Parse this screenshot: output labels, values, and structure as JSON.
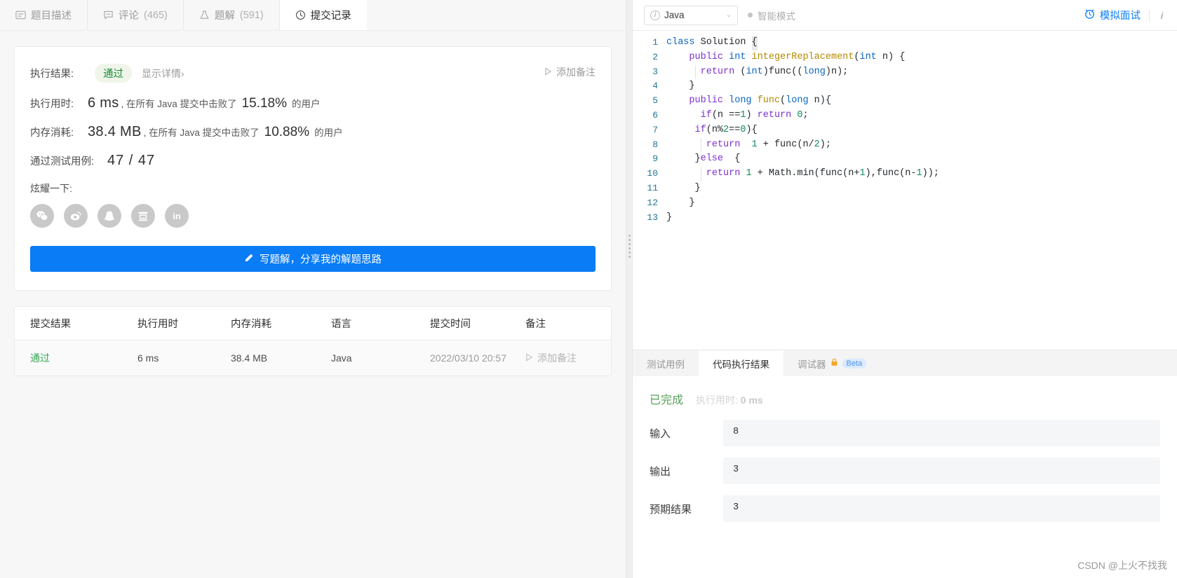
{
  "left": {
    "tabs": [
      {
        "label": "题目描述",
        "icon": "description-icon",
        "count": "",
        "active": false
      },
      {
        "label": "评论",
        "icon": "comment-icon",
        "count": "(465)",
        "active": false
      },
      {
        "label": "题解",
        "icon": "flask-icon",
        "count": "(591)",
        "active": false
      },
      {
        "label": "提交记录",
        "icon": "clock-icon",
        "count": "",
        "active": true
      }
    ],
    "result": {
      "exec_result_label": "执行结果:",
      "status": "通过",
      "show_detail": "显示详情",
      "show_detail_chevron": "›",
      "add_note_label": "添加备注",
      "runtime_label": "执行用时:",
      "runtime_value": "6 ms",
      "runtime_mid": ", 在所有 Java 提交中击败了",
      "runtime_pct": "15.18%",
      "runtime_suffix": "的用户",
      "memory_label": "内存消耗:",
      "memory_value": "38.4 MB",
      "memory_mid": ", 在所有 Java 提交中击败了",
      "memory_pct": "10.88%",
      "memory_suffix": "的用户",
      "testcase_label": "通过测试用例:",
      "testcase_value": "47 / 47",
      "share_label": "炫耀一下:",
      "share_icons": [
        "wechat-icon",
        "weibo-icon",
        "qq-icon",
        "douban-icon",
        "linkedin-icon"
      ],
      "write_button": "写题解，分享我的解题思路",
      "write_button_icon": "pencil-icon"
    },
    "table": {
      "headers": [
        "提交结果",
        "执行用时",
        "内存消耗",
        "语言",
        "提交时间",
        "备注"
      ],
      "rows": [
        {
          "status": "通过",
          "runtime": "6 ms",
          "memory": "38.4 MB",
          "language": "Java",
          "time": "2022/03/10 20:57",
          "note": "添加备注",
          "note_icon": "play-outline-icon"
        }
      ]
    }
  },
  "right": {
    "header": {
      "language": "Java",
      "language_info_icon": "info-circle-icon",
      "chevron": "⌄",
      "smart_mode": "智能模式",
      "mock_interview": "模拟面试",
      "mock_icon": "alarm-clock-icon",
      "info_icon": "italic-i-icon"
    },
    "editor": {
      "lines": [
        {
          "n": "1",
          "html": "<span class='kw2'>class</span> <span class='id'>Solution</span> <span class='caret'>{</span>"
        },
        {
          "n": "2",
          "html": "    <span class='kw'>public</span> <span class='ty'>int</span> <span class='fn'>integerReplacement</span>(<span class='ty'>int</span> n) {"
        },
        {
          "n": "3",
          "html": "     <span class='guide'></span> <span class='kw'>return</span> (<span class='ty'>int</span>)func((<span class='ty'>long</span>)n);"
        },
        {
          "n": "4",
          "html": "    }"
        },
        {
          "n": "5",
          "html": "    <span class='kw'>public</span> <span class='ty'>long</span> <span class='fn'>func</span>(<span class='ty'>long</span> n){"
        },
        {
          "n": "6",
          "html": "      <span class='kw'>if</span>(n ==<span class='num'>1</span>) <span class='kw'>return</span> <span class='num'>0</span>;"
        },
        {
          "n": "7",
          "html": "     <span class='kw'>if</span>(n%<span class='num'>2</span>==<span class='num'>0</span>){"
        },
        {
          "n": "8",
          "html": "      <span class='guide'></span> <span class='kw'>return</span>  <span class='num'>1</span> + func(n/<span class='num'>2</span>);"
        },
        {
          "n": "9",
          "html": "     }<span class='kw'>else</span>  {"
        },
        {
          "n": "10",
          "html": "      <span class='guide'></span> <span class='kw'>return</span> <span class='num'>1</span> + Math.min(func(n+<span class='num'>1</span>),func(n-<span class='num'>1</span>));"
        },
        {
          "n": "11",
          "html": "     }"
        },
        {
          "n": "12",
          "html": "    }"
        },
        {
          "n": "13",
          "html": "}"
        }
      ],
      "plain_code": "class Solution {\n    public int integerReplacement(int n) {\n      return (int)func((long)n);\n    }\n    public long func(long n){\n      if(n ==1) return 0;\n     if(n%2==0){\n       return  1 + func(n/2);\n     }else  {\n       return 1 + Math.min(func(n+1),func(n-1));\n     }\n    }\n}"
    },
    "bottom": {
      "tabs": [
        {
          "label": "测试用例",
          "active": false,
          "lock": false,
          "beta": ""
        },
        {
          "label": "代码执行结果",
          "active": true,
          "lock": false,
          "beta": ""
        },
        {
          "label": "调试器",
          "active": false,
          "lock": true,
          "beta": "Beta",
          "lock_icon": "lock-icon"
        }
      ],
      "status": "已完成",
      "runtime_label": "执行用时:",
      "runtime_value": "0 ms",
      "io": [
        {
          "label": "输入",
          "value": "8"
        },
        {
          "label": "输出",
          "value": "3"
        },
        {
          "label": "预期结果",
          "value": "3"
        }
      ]
    }
  },
  "watermark": "CSDN @上火不找我",
  "colors": {
    "accent_blue": "#0a7cf6",
    "pass_green": "#1a8a36",
    "row_green": "#34a853",
    "done_green": "#57a05a",
    "beta_bg": "#daeaff",
    "lock_orange": "#f5a623"
  }
}
